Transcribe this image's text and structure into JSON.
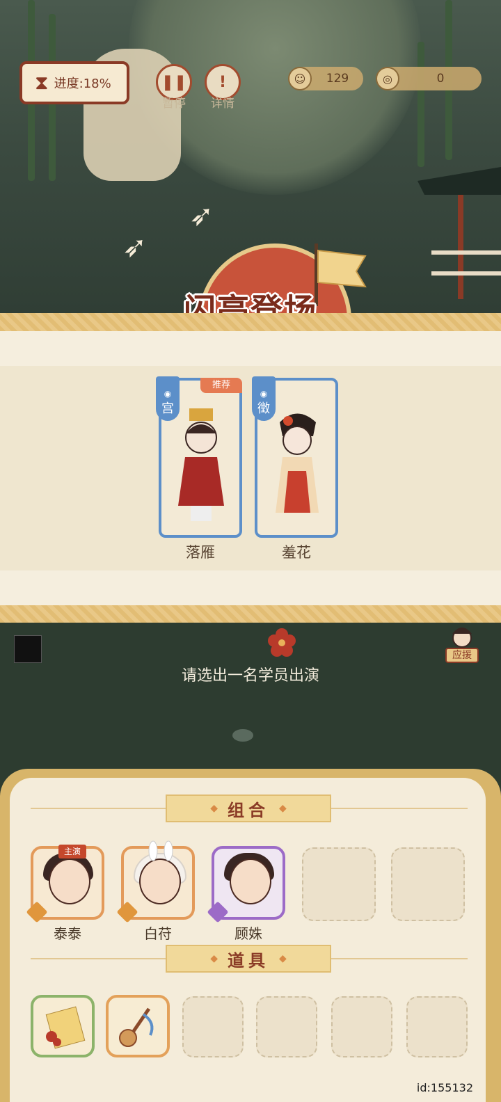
{
  "hud": {
    "progress_label": "进度:18%",
    "pause_label": "暂停",
    "details_label": "详情",
    "currency_a_value": "129",
    "currency_b_value": "0"
  },
  "stage": {
    "title": "闪亮登场"
  },
  "candidates": [
    {
      "name": "落雁",
      "badge": "宫",
      "recommended_tag": "推荐",
      "color": "#5c8fc9"
    },
    {
      "name": "羞花",
      "badge": "徵",
      "color": "#5c8fc9"
    }
  ],
  "prompt": "请选出一名学员出演",
  "remind_label": "应援",
  "panel": {
    "combo_title": "组合",
    "items_title": "道具",
    "members": [
      {
        "name": "泰泰",
        "lead_label": "主演",
        "border": "orange"
      },
      {
        "name": "白苻",
        "border": "orange"
      },
      {
        "name": "顾姝",
        "border": "purple"
      }
    ],
    "empty_member_slots": 2,
    "empty_item_slots": 4
  },
  "footer": {
    "id_text": "id:155132"
  }
}
